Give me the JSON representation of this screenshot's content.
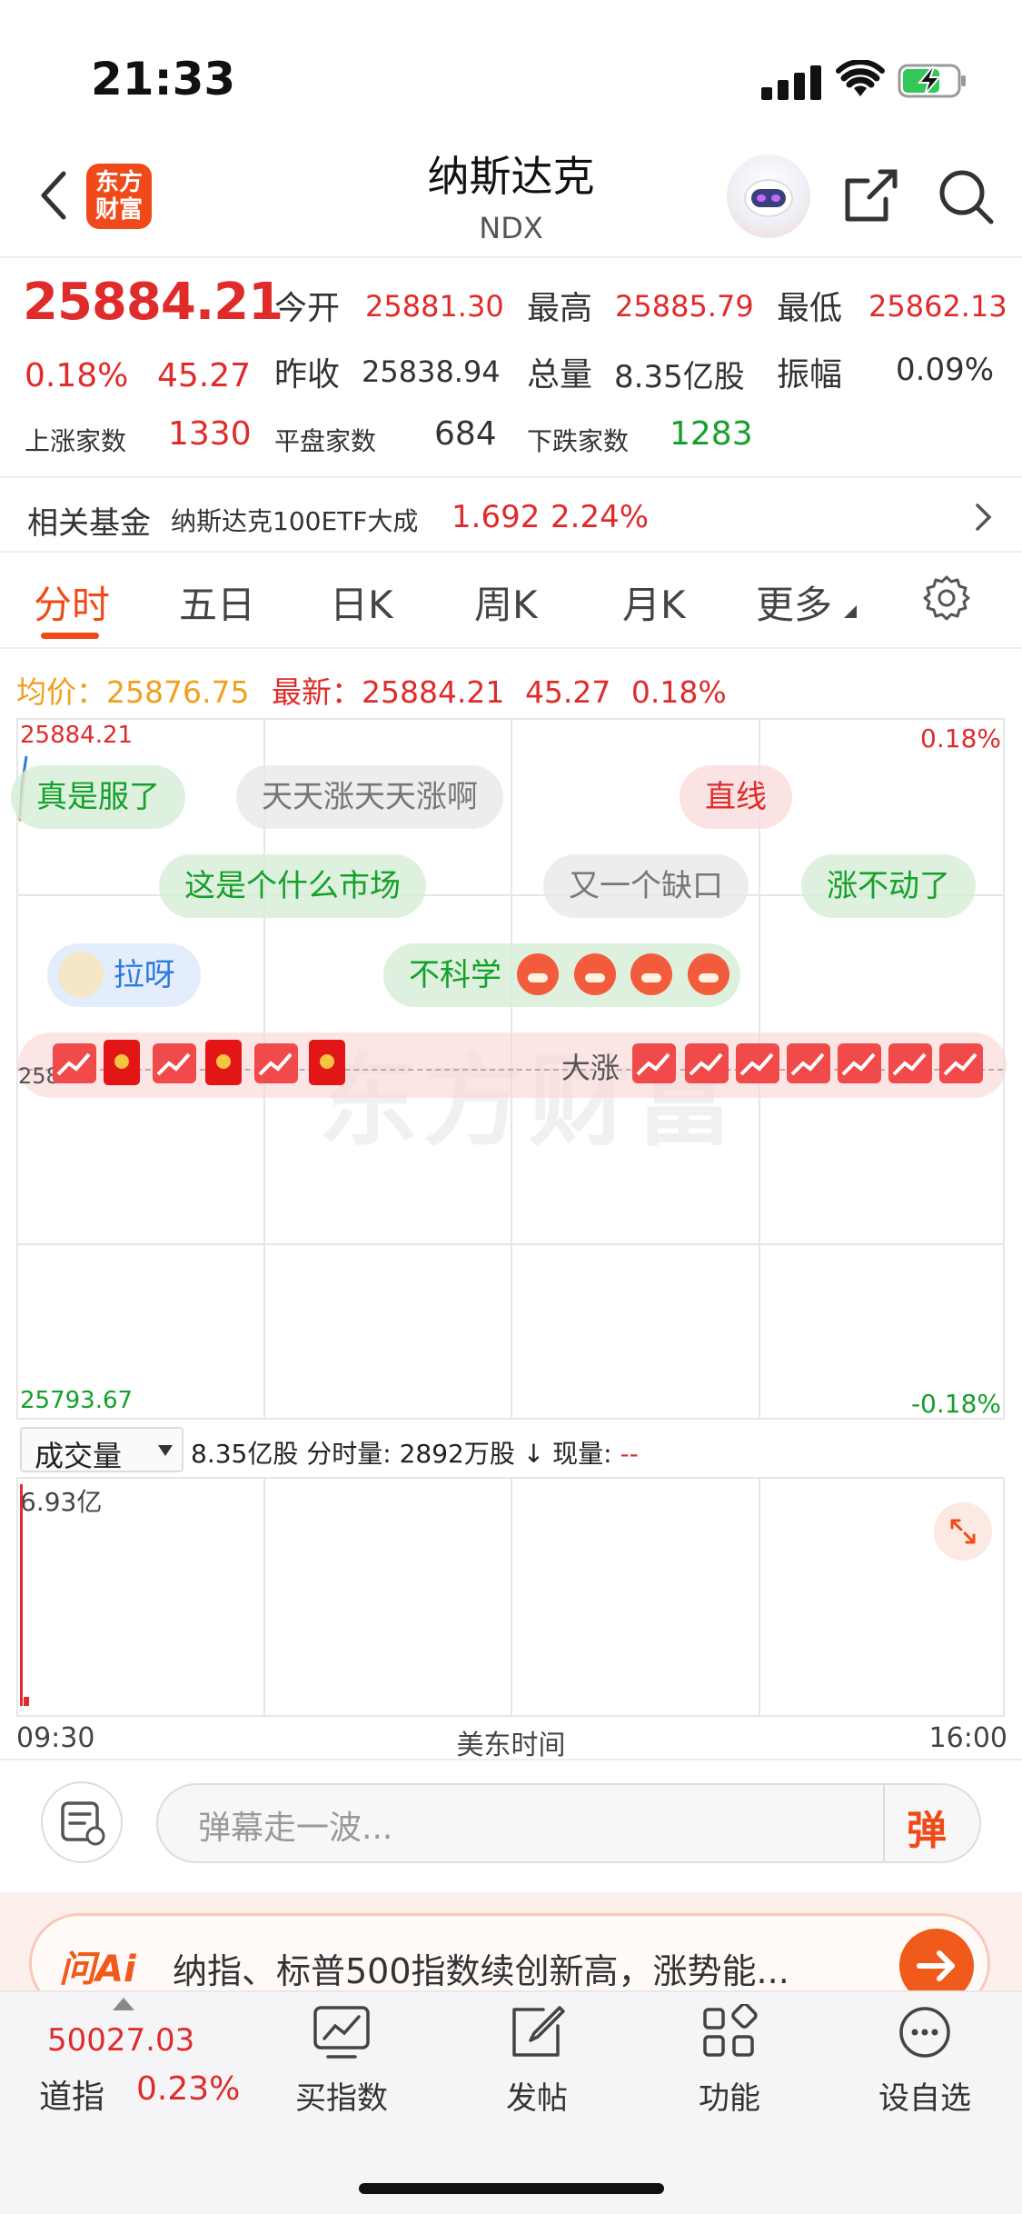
{
  "status_bar": {
    "time": "21:33"
  },
  "header": {
    "logo_text": "东方财富",
    "title": "纳斯达克",
    "subtitle": "NDX"
  },
  "quote": {
    "price": "25884.21",
    "change_pct": "0.18%",
    "change": "45.27",
    "open_label": "今开",
    "open": "25881.30",
    "high_label": "最高",
    "high": "25885.79",
    "low_label": "最低",
    "low": "25862.13",
    "prev_close_label": "昨收",
    "prev_close": "25838.94",
    "volume_label": "总量",
    "volume": "8.35亿股",
    "amplitude_label": "振幅",
    "amplitude": "0.09%",
    "up_count_label": "上涨家数",
    "up_count": "1330",
    "flat_count_label": "平盘家数",
    "flat_count": "684",
    "down_count_label": "下跌家数",
    "down_count": "1283"
  },
  "fund": {
    "label": "相关基金",
    "name": "纳斯达克100ETF大成",
    "price": "1.692",
    "pct": "2.24%"
  },
  "tabs": [
    {
      "label": "分时"
    },
    {
      "label": "五日"
    },
    {
      "label": "日K"
    },
    {
      "label": "周K"
    },
    {
      "label": "月K"
    },
    {
      "label": "更多"
    }
  ],
  "info_line": {
    "avg_label": "均价：",
    "avg": "25876.75",
    "latest_label": "最新：",
    "latest": "25884.21",
    "change": "45.27",
    "pct": "0.18%"
  },
  "chart": {
    "y_top": "25884.21",
    "y_bottom": "25793.67",
    "pct_top": "0.18%",
    "pct_bottom": "-0.18%",
    "mid_label": "258",
    "watermark": "东方财富",
    "danmaku": {
      "d1": "真是服了",
      "d2": "天天涨天天涨啊",
      "d3": "直线",
      "d4": "这是个什么市场",
      "d5": "又一个缺口",
      "d6": "涨不动了",
      "d7": "拉呀",
      "d8": "不科学",
      "d9": "大涨"
    }
  },
  "volume": {
    "dropdown": "成交量",
    "total": "8.35亿股",
    "period_label": "分时量:",
    "period_value": "2892万股",
    "arrow": "↓",
    "current_label": "现量:",
    "current_value": "--",
    "y_max": "6.93亿"
  },
  "time_axis": {
    "start": "09:30",
    "middle": "美东时间",
    "end": "16:00"
  },
  "danmu_input": {
    "placeholder": "弹幕走一波...",
    "send_label": "弹"
  },
  "ai_banner": {
    "logo": "问Ai",
    "text": "纳指、标普500指数续创新高，涨势能..."
  },
  "bottom_nav": {
    "index_value": "50027.03",
    "index_name": "道指",
    "index_pct": "0.23%",
    "items": [
      {
        "label": "买指数",
        "icon": "chart-icon"
      },
      {
        "label": "发帖",
        "icon": "edit-icon"
      },
      {
        "label": "功能",
        "icon": "grid-icon"
      },
      {
        "label": "设自选",
        "icon": "more-icon"
      }
    ]
  },
  "colors": {
    "up": "#e02b2b",
    "down": "#14a02a",
    "accent": "#f04a1a",
    "avg": "#f0a01e"
  }
}
